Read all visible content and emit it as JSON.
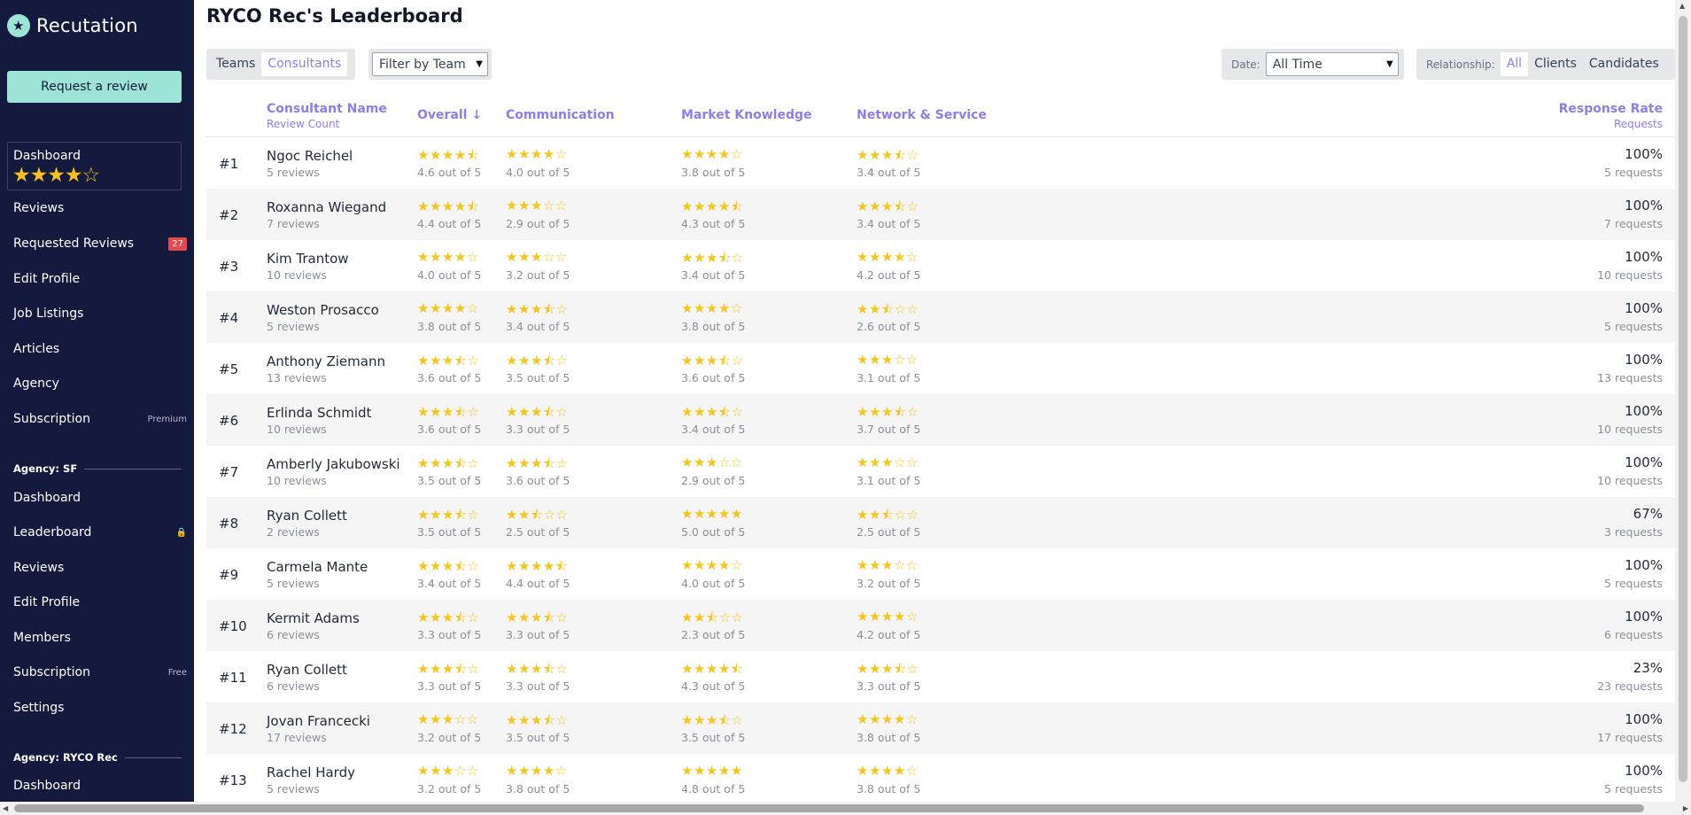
{
  "app": {
    "name": "Recutation"
  },
  "sidebar": {
    "request_review_label": "Request a review",
    "dashboard_label": "Dashboard",
    "dashboard_stars": "★★★★☆",
    "items": [
      {
        "label": "Reviews"
      },
      {
        "label": "Requested Reviews",
        "badge": "27"
      },
      {
        "label": "Edit Profile"
      },
      {
        "label": "Job Listings"
      },
      {
        "label": "Articles"
      },
      {
        "label": "Agency"
      },
      {
        "label": "Subscription",
        "tag": "Premium"
      }
    ],
    "agency_sf": {
      "header": "Agency: SF",
      "items": [
        {
          "label": "Dashboard"
        },
        {
          "label": "Leaderboard"
        },
        {
          "label": "Reviews"
        },
        {
          "label": "Edit Profile"
        },
        {
          "label": "Members"
        },
        {
          "label": "Subscription",
          "tag": "Free"
        },
        {
          "label": "Settings"
        }
      ]
    },
    "agency_ryco": {
      "header": "Agency: RYCO Rec",
      "items": [
        {
          "label": "Dashboard"
        }
      ]
    }
  },
  "main": {
    "title": "RYCO Rec's Leaderboard",
    "view_toggle": {
      "teams": "Teams",
      "consultants": "Consultants",
      "active": "Consultants"
    },
    "team_filter": "Filter by Team",
    "date": {
      "label": "Date:",
      "value": "All Time"
    },
    "relationship": {
      "label": "Relationship:",
      "options": [
        "All",
        "Clients",
        "Candidates"
      ],
      "active": "All"
    }
  },
  "table": {
    "headers": {
      "name": "Consultant Name",
      "name_sub": "Review Count",
      "overall": "Overall ↓",
      "communication": "Communication",
      "market": "Market Knowledge",
      "network": "Network & Service",
      "response": "Response Rate",
      "response_sub": "Requests"
    },
    "rows": [
      {
        "rank": "#1",
        "name": "Ngoc Reichel",
        "reviews": "5 reviews",
        "overall": 4.6,
        "communication": 4.0,
        "market": 3.8,
        "network": 3.4,
        "rate": "100%",
        "requests": "5 requests"
      },
      {
        "rank": "#2",
        "name": "Roxanna Wiegand",
        "reviews": "7 reviews",
        "overall": 4.4,
        "communication": 2.9,
        "market": 4.3,
        "network": 3.4,
        "rate": "100%",
        "requests": "7 requests"
      },
      {
        "rank": "#3",
        "name": "Kim Trantow",
        "reviews": "10 reviews",
        "overall": 4.0,
        "communication": 3.2,
        "market": 3.4,
        "network": 4.2,
        "rate": "100%",
        "requests": "10 requests"
      },
      {
        "rank": "#4",
        "name": "Weston Prosacco",
        "reviews": "5 reviews",
        "overall": 3.8,
        "communication": 3.4,
        "market": 3.8,
        "network": 2.6,
        "rate": "100%",
        "requests": "5 requests"
      },
      {
        "rank": "#5",
        "name": "Anthony Ziemann",
        "reviews": "13 reviews",
        "overall": 3.6,
        "communication": 3.5,
        "market": 3.6,
        "network": 3.1,
        "rate": "100%",
        "requests": "13 requests"
      },
      {
        "rank": "#6",
        "name": "Erlinda Schmidt",
        "reviews": "10 reviews",
        "overall": 3.6,
        "communication": 3.3,
        "market": 3.4,
        "network": 3.7,
        "rate": "100%",
        "requests": "10 requests"
      },
      {
        "rank": "#7",
        "name": "Amberly Jakubowski",
        "reviews": "10 reviews",
        "overall": 3.5,
        "communication": 3.6,
        "market": 2.9,
        "network": 3.1,
        "rate": "100%",
        "requests": "10 requests"
      },
      {
        "rank": "#8",
        "name": "Ryan Collett",
        "reviews": "2 reviews",
        "overall": 3.5,
        "communication": 2.5,
        "market": 5.0,
        "network": 2.5,
        "rate": "67%",
        "requests": "3 requests"
      },
      {
        "rank": "#9",
        "name": "Carmela Mante",
        "reviews": "5 reviews",
        "overall": 3.4,
        "communication": 4.4,
        "market": 4.0,
        "network": 3.2,
        "rate": "100%",
        "requests": "5 requests"
      },
      {
        "rank": "#10",
        "name": "Kermit Adams",
        "reviews": "6 reviews",
        "overall": 3.3,
        "communication": 3.3,
        "market": 2.3,
        "network": 4.2,
        "rate": "100%",
        "requests": "6 requests"
      },
      {
        "rank": "#11",
        "name": "Ryan Collett",
        "reviews": "6 reviews",
        "overall": 3.3,
        "communication": 3.3,
        "market": 4.3,
        "network": 3.3,
        "rate": "23%",
        "requests": "23 requests"
      },
      {
        "rank": "#12",
        "name": "Jovan Francecki",
        "reviews": "17 reviews",
        "overall": 3.2,
        "communication": 3.5,
        "market": 3.5,
        "network": 3.8,
        "rate": "100%",
        "requests": "17 requests"
      },
      {
        "rank": "#13",
        "name": "Rachel Hardy",
        "reviews": "5 reviews",
        "overall": 3.2,
        "communication": 3.8,
        "market": 4.8,
        "network": 3.8,
        "rate": "100%",
        "requests": "5 requests"
      }
    ],
    "score_suffix": " out of 5"
  },
  "colors": {
    "sidebar": "#141a3d",
    "accent": "#8b7ff0",
    "mint": "#9ee4d6",
    "star": "#f5c518"
  }
}
